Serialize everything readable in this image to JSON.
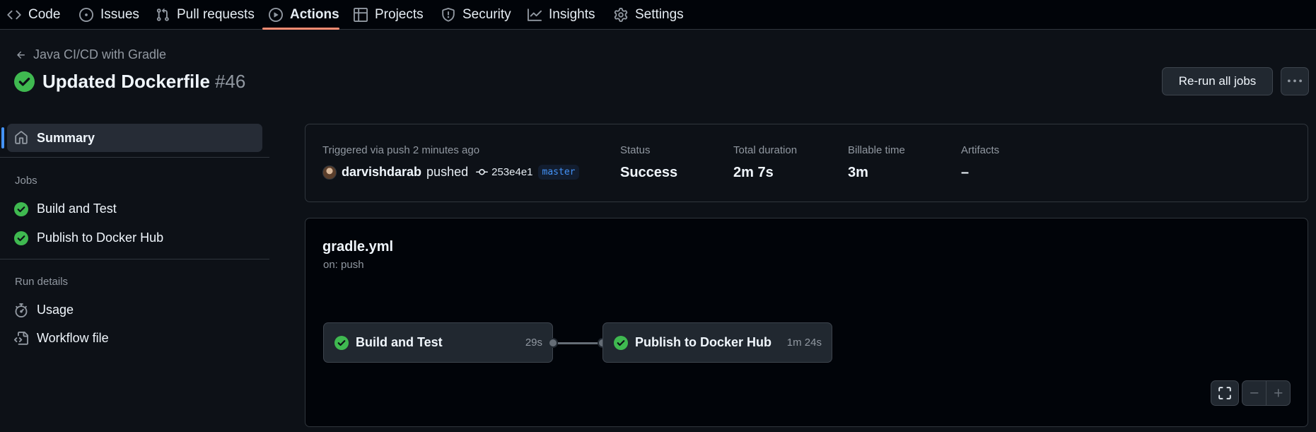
{
  "nav": {
    "items": [
      {
        "label": "Code",
        "icon": "code-icon"
      },
      {
        "label": "Issues",
        "icon": "issue-opened-icon"
      },
      {
        "label": "Pull requests",
        "icon": "git-pull-request-icon"
      },
      {
        "label": "Actions",
        "icon": "play-icon",
        "active": true
      },
      {
        "label": "Projects",
        "icon": "table-icon"
      },
      {
        "label": "Security",
        "icon": "shield-icon"
      },
      {
        "label": "Insights",
        "icon": "graph-icon"
      },
      {
        "label": "Settings",
        "icon": "gear-icon"
      }
    ]
  },
  "header": {
    "back_label": "Java CI/CD with Gradle",
    "run_title": "Updated Dockerfile",
    "run_number": "#46",
    "rerun_label": "Re-run all jobs"
  },
  "sidebar": {
    "summary_label": "Summary",
    "jobs_heading": "Jobs",
    "jobs": [
      "Build and Test",
      "Publish to Docker Hub"
    ],
    "run_details_heading": "Run details",
    "details": [
      "Usage",
      "Workflow file"
    ]
  },
  "summary": {
    "trigger_text": "Triggered via push 2 minutes ago",
    "actor": "darvishdarab",
    "action": "pushed",
    "commit": "253e4e1",
    "branch": "master",
    "status_label": "Status",
    "status_value": "Success",
    "duration_label": "Total duration",
    "duration_value": "2m 7s",
    "billable_label": "Billable time",
    "billable_value": "3m",
    "artifacts_label": "Artifacts",
    "artifacts_value": "–"
  },
  "workflow": {
    "file": "gradle.yml",
    "trigger": "on: push",
    "jobs": [
      {
        "name": "Build and Test",
        "duration": "29s",
        "status": "success"
      },
      {
        "name": "Publish to Docker Hub",
        "duration": "1m 24s",
        "status": "success"
      }
    ]
  },
  "colors": {
    "background": "#0d1117",
    "success": "#3fb950",
    "accent": "#4493f8",
    "active_tab_underline": "#fd8c73"
  }
}
